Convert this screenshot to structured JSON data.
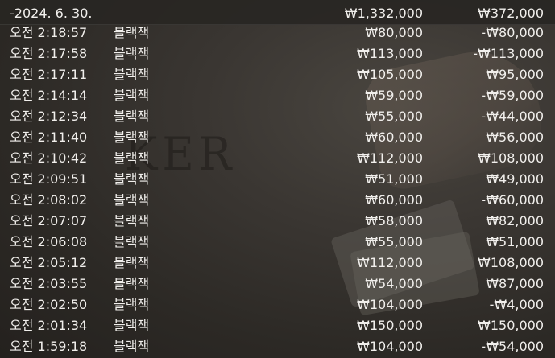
{
  "summary": {
    "date": "-2024. 6. 30.",
    "total_bet": "₩1,332,000",
    "total_net": "₩372,000"
  },
  "background": {
    "table_text": "KER"
  },
  "rows": [
    {
      "time": "오전 2:18:57",
      "game": "블랙잭",
      "bet": "₩80,000",
      "net": "-₩80,000"
    },
    {
      "time": "오전 2:17:58",
      "game": "블랙잭",
      "bet": "₩113,000",
      "net": "-₩113,000"
    },
    {
      "time": "오전 2:17:11",
      "game": "블랙잭",
      "bet": "₩105,000",
      "net": "₩95,000"
    },
    {
      "time": "오전 2:14:14",
      "game": "블랙잭",
      "bet": "₩59,000",
      "net": "-₩59,000"
    },
    {
      "time": "오전 2:12:34",
      "game": "블랙잭",
      "bet": "₩55,000",
      "net": "-₩44,000"
    },
    {
      "time": "오전 2:11:40",
      "game": "블랙잭",
      "bet": "₩60,000",
      "net": "₩56,000"
    },
    {
      "time": "오전 2:10:42",
      "game": "블랙잭",
      "bet": "₩112,000",
      "net": "₩108,000"
    },
    {
      "time": "오전 2:09:51",
      "game": "블랙잭",
      "bet": "₩51,000",
      "net": "₩49,000"
    },
    {
      "time": "오전 2:08:02",
      "game": "블랙잭",
      "bet": "₩60,000",
      "net": "-₩60,000"
    },
    {
      "time": "오전 2:07:07",
      "game": "블랙잭",
      "bet": "₩58,000",
      "net": "₩82,000"
    },
    {
      "time": "오전 2:06:08",
      "game": "블랙잭",
      "bet": "₩55,000",
      "net": "₩51,000"
    },
    {
      "time": "오전 2:05:12",
      "game": "블랙잭",
      "bet": "₩112,000",
      "net": "₩108,000"
    },
    {
      "time": "오전 2:03:55",
      "game": "블랙잭",
      "bet": "₩54,000",
      "net": "₩87,000"
    },
    {
      "time": "오전 2:02:50",
      "game": "블랙잭",
      "bet": "₩104,000",
      "net": "-₩4,000"
    },
    {
      "time": "오전 2:01:34",
      "game": "블랙잭",
      "bet": "₩150,000",
      "net": "₩150,000"
    },
    {
      "time": "오전 1:59:18",
      "game": "블랙잭",
      "bet": "₩104,000",
      "net": "-₩54,000"
    }
  ]
}
